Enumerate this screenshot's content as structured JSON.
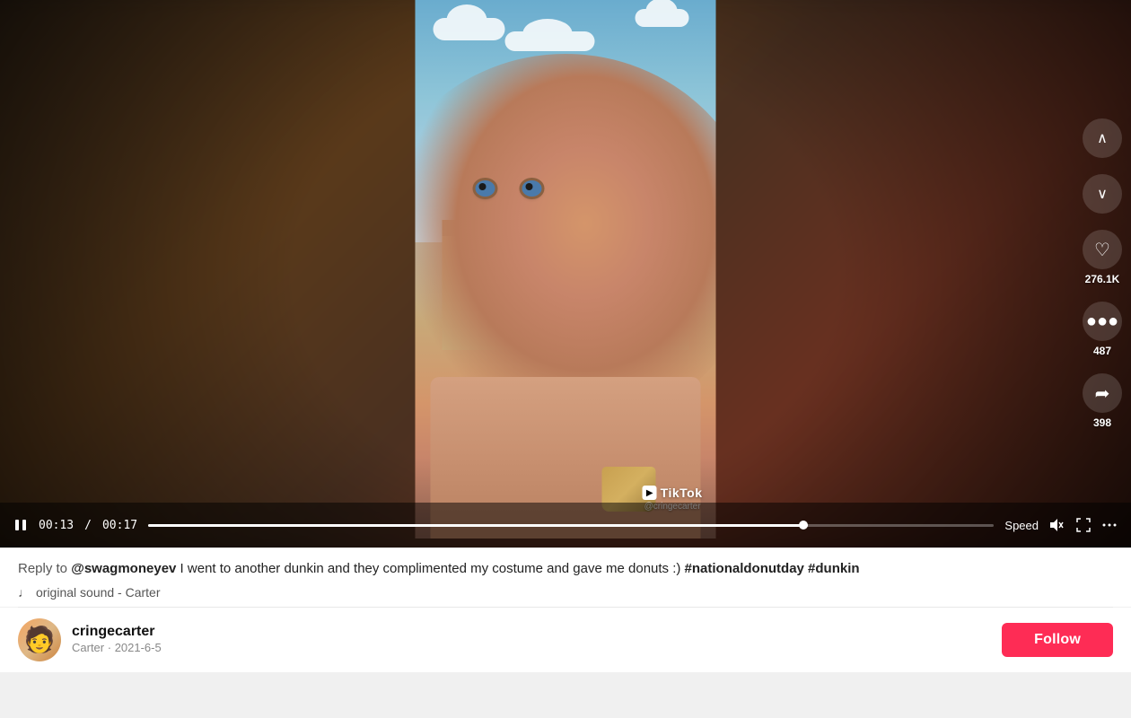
{
  "page": {
    "bg_color": "#f0f0f0"
  },
  "video": {
    "duration_total": "00:17",
    "duration_current": "00:13",
    "progress_percent": 76,
    "tiktok_watermark": "TikTok",
    "tiktok_handle": "@cringecarter",
    "controls": {
      "speed_label": "Speed",
      "more_label": "..."
    }
  },
  "actions": {
    "like_count": "276.1K",
    "comment_count": "487",
    "share_count": "398"
  },
  "caption": {
    "prefix": "Reply to ",
    "mention": "@swagmoneyev",
    "body": " I went to another dunkin and they complimented my costume and gave me donuts :)",
    "hashtags": " #nationaldonutday #dunkin"
  },
  "sound": {
    "icon": "♩",
    "text": "original sound - Carter"
  },
  "author": {
    "username": "cringecarter",
    "display_name": "Carter",
    "date": "2021-6-5",
    "follow_label": "Follow"
  }
}
